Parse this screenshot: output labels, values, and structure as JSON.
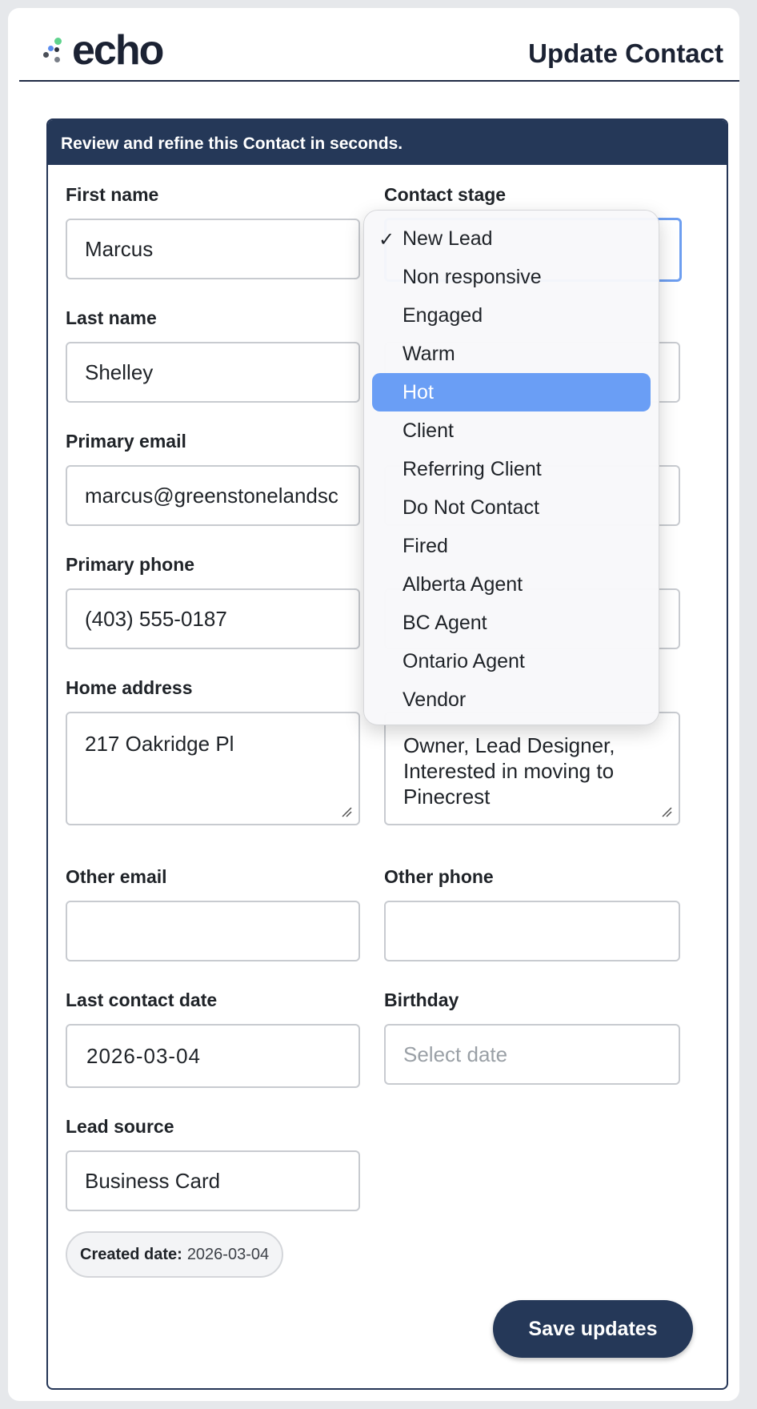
{
  "header": {
    "brand": "echo",
    "title": "Update Contact"
  },
  "panel": {
    "banner": "Review and refine this Contact in seconds."
  },
  "fields": {
    "first_name": {
      "label": "First name",
      "value": "Marcus"
    },
    "contact_stage": {
      "label": "Contact stage"
    },
    "last_name": {
      "label": "Last name",
      "value": "Shelley"
    },
    "primary_email": {
      "label": "Primary email",
      "value": "marcus@greenstonelandsc"
    },
    "primary_phone": {
      "label": "Primary phone",
      "value": "(403) 555-0187"
    },
    "home_address": {
      "label": "Home address",
      "value": "217 Oakridge Pl"
    },
    "notes": {
      "value": "Owner, Lead Designer, Interested in moving to Pinecrest"
    },
    "other_email": {
      "label": "Other email",
      "value": ""
    },
    "other_phone": {
      "label": "Other phone",
      "value": ""
    },
    "last_contact_date": {
      "label": "Last contact date",
      "value": "2026-03-04"
    },
    "birthday": {
      "label": "Birthday",
      "placeholder": "Select date"
    },
    "lead_source": {
      "label": "Lead source",
      "value": "Business Card"
    }
  },
  "created": {
    "label": "Created date:",
    "value": "2026-03-04"
  },
  "save_button": "Save updates",
  "stage_dropdown": {
    "checked": "New Lead",
    "highlighted": "Hot",
    "options": [
      "New Lead",
      "Non responsive",
      "Engaged",
      "Warm",
      "Hot",
      "Client",
      "Referring Client",
      "Do Not Contact",
      "Fired",
      "Alberta Agent",
      "BC Agent",
      "Ontario Agent",
      "Vendor"
    ]
  },
  "colors": {
    "navy": "#253858",
    "highlight": "#6a9ef5",
    "logo_green": "#5fd38d",
    "logo_blue": "#5b8def"
  }
}
